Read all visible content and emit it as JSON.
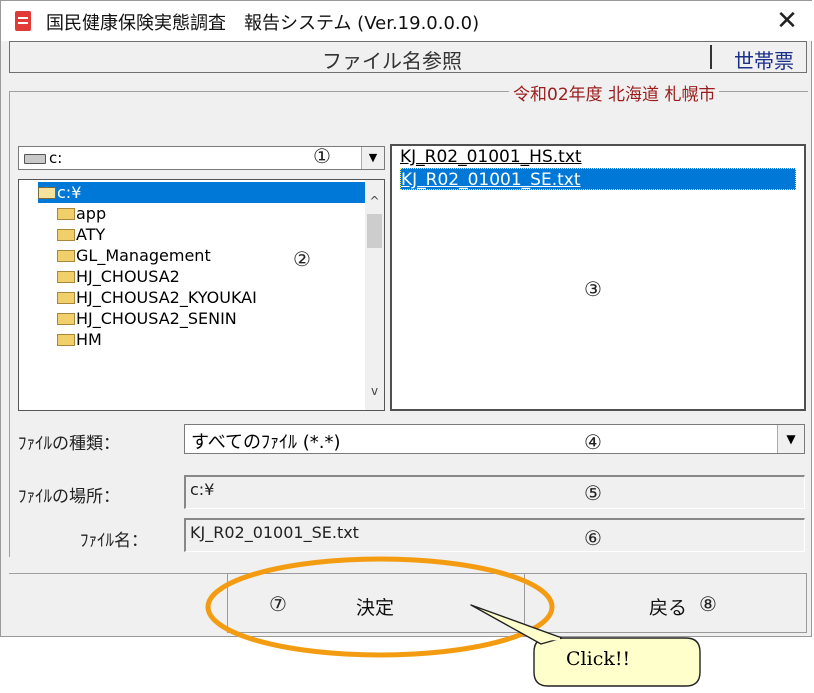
{
  "window": {
    "title": "国民健康保険実態調査　報告システム (Ver.19.0.0.0)",
    "close_glyph": "✕"
  },
  "header": {
    "title": "ファイル名参照",
    "form_name": "世帯票"
  },
  "group": {
    "label": "令和02年度 北海道 札幌市"
  },
  "drive": {
    "value": "c:",
    "arrow": "▼"
  },
  "directories": {
    "items": [
      {
        "label": "c:¥",
        "selected": true,
        "icon": "open-folder-icon"
      },
      {
        "label": "app",
        "icon": "folder-icon"
      },
      {
        "label": "ATY",
        "icon": "folder-icon"
      },
      {
        "label": "GL_Management",
        "icon": "folder-icon"
      },
      {
        "label": "HJ_CHOUSA2",
        "icon": "folder-icon"
      },
      {
        "label": "HJ_CHOUSA2_KYOUKAI",
        "icon": "folder-icon"
      },
      {
        "label": "HJ_CHOUSA2_SENIN",
        "icon": "folder-icon"
      },
      {
        "label": "HM",
        "icon": "folder-icon"
      }
    ],
    "scroll_up": "^",
    "scroll_down": "v"
  },
  "files": {
    "items": [
      {
        "label": "KJ_R02_01001_HS.txt",
        "selected": false
      },
      {
        "label": "KJ_R02_01001_SE.txt",
        "selected": true
      }
    ]
  },
  "filetype": {
    "label": "ﾌｧｲﾙの種類：",
    "value": "すべてのﾌｧｲﾙ (*.*)",
    "arrow": "▼"
  },
  "location": {
    "label": "ﾌｧｲﾙの場所：",
    "value": "c:¥"
  },
  "filename": {
    "label": "ﾌｧｲﾙ名：",
    "value": "KJ_R02_01001_SE.txt"
  },
  "buttons": {
    "ok": "決定",
    "back": "戻る"
  },
  "markers": {
    "m1": "①",
    "m2": "②",
    "m3": "③",
    "m4": "④",
    "m5": "⑤",
    "m6": "⑥",
    "m7": "⑦",
    "m8": "⑧"
  },
  "callout": {
    "text": "Click!!",
    "highlight_color": "#f39c12",
    "bubble_color": "#ffffcc"
  },
  "colors": {
    "selection": "#0078d7",
    "group_label": "#9b1c1c",
    "form_name": "#1a2f8a"
  }
}
